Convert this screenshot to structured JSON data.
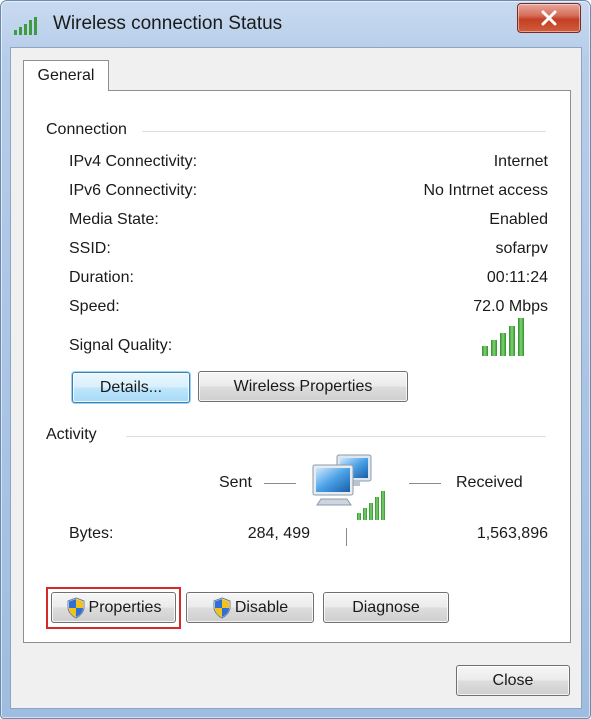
{
  "window": {
    "title": "Wireless connection Status"
  },
  "tabs": [
    {
      "label": "General"
    }
  ],
  "connection": {
    "group_label": "Connection",
    "rows": [
      {
        "label": "IPv4 Connectivity:",
        "value": "Internet"
      },
      {
        "label": "IPv6 Connectivity:",
        "value": "No Intrnet access"
      },
      {
        "label": "Media State:",
        "value": "Enabled"
      },
      {
        "label": "SSID:",
        "value": "sofarpv"
      },
      {
        "label": "Duration:",
        "value": "00:11:24"
      },
      {
        "label": "Speed:",
        "value": "72.0 Mbps"
      }
    ],
    "signal_quality_label": "Signal Quality:",
    "signal_bars_total": 5,
    "signal_bars_lit": 5,
    "details_label": "Details...",
    "wireless_properties_label": "Wireless Properties"
  },
  "activity": {
    "group_label": "Activity",
    "sent_label": "Sent",
    "received_label": "Received",
    "bytes_label": "Bytes:",
    "bytes_sent": "284, 499",
    "bytes_received": "1,563,896"
  },
  "buttons": {
    "properties_label": "Properties",
    "disable_label": "Disable",
    "diagnose_label": "Diagnose",
    "close_label": "Close"
  },
  "icons": {
    "title_icon": "signal-bars-icon",
    "close_icon": "close-icon",
    "shield_icon": "uac-shield-icon",
    "network_icon": "network-computers-icon"
  },
  "colors": {
    "signal_green": "#3aa53a",
    "highlight_red": "#d42a2a",
    "close_red": "#c33f25",
    "title_blue": "#b6cde9"
  }
}
